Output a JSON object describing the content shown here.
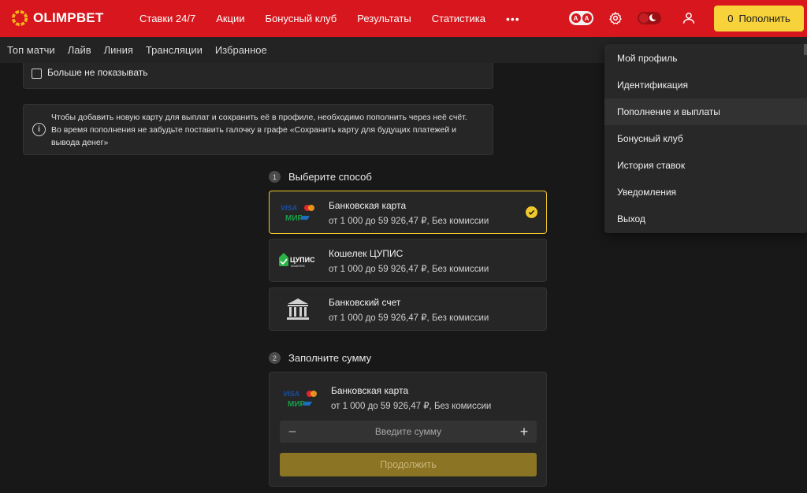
{
  "header": {
    "logo_text": "OLIMPBET",
    "nav": [
      "Ставки 24/7",
      "Акции",
      "Бонусный клуб",
      "Результаты",
      "Статистика"
    ],
    "more_label": "•••",
    "font_toggle": [
      "A",
      "A"
    ],
    "deposit": {
      "balance": "0",
      "label": "Пополнить"
    }
  },
  "subnav": [
    "Топ матчи",
    "Лайв",
    "Линия",
    "Трансляции",
    "Избранное"
  ],
  "notice": {
    "dont_show_label": "Больше не показывать",
    "info_lines": [
      "Чтобы добавить новую карту для выплат и сохранить её в профиле, необходимо пополнить через неё счёт.",
      "Во время пополнения не забудьте поставить галочку в графе «Сохранить карту для будущих платежей и вывода денег»"
    ]
  },
  "step1": {
    "num": "1",
    "title": "Выберите способ",
    "methods": [
      {
        "title": "Банковская карта",
        "subtitle": "от 1 000 до 59 926,47 ₽, Без комиссии",
        "icon": "visa-mir-icon",
        "selected": true
      },
      {
        "title": "Кошелек ЦУПИС",
        "subtitle": "от 1 000 до 59 926,47 ₽, Без комиссии",
        "icon": "cupis-icon",
        "logo_text": "ЦУПИС",
        "logo_sub": "кошелек"
      },
      {
        "title": "Банковский счет",
        "subtitle": "от 1 000 до 59 926,47 ₽, Без комиссии",
        "icon": "bank-icon"
      }
    ]
  },
  "step2": {
    "num": "2",
    "title": "Заполните сумму",
    "method_title": "Банковская карта",
    "method_subtitle": "от 1 000 до 59 926,47 ₽, Без комиссии",
    "amount_placeholder": "Введите сумму",
    "continue_label": "Продолжить"
  },
  "user_menu": [
    "Мой профиль",
    "Идентификация",
    "Пополнение и выплаты",
    "Бонусный клуб",
    "История ставок",
    "Уведомления",
    "Выход"
  ],
  "logos": {
    "visa": "VISA",
    "mir": "МИР"
  },
  "colors": {
    "brand_red": "#d7171d",
    "accent_yellow": "#f7d23a",
    "selected_border": "#f0c92d"
  }
}
